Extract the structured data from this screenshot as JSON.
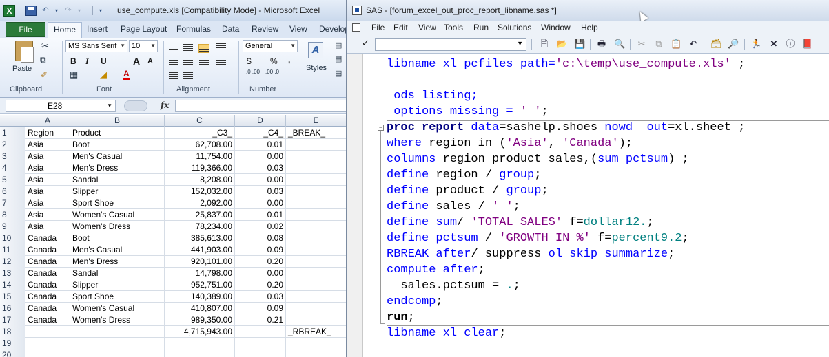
{
  "excel": {
    "title": "use_compute.xls  [Compatibility Mode]  -  Microsoft Excel",
    "app_icon_letter": "X",
    "tabs": {
      "file": "File",
      "home": "Home",
      "insert": "Insert",
      "page_layout": "Page Layout",
      "formulas": "Formulas",
      "data": "Data",
      "review": "Review",
      "view": "View",
      "developer": "Develop"
    },
    "ribbon": {
      "clipboard_label": "Clipboard",
      "paste_label": "Paste",
      "font_label": "Font",
      "font_name": "MS Sans Serif",
      "font_size": "10",
      "bold": "B",
      "italic": "I",
      "underline": "U",
      "grow_font": "A",
      "shrink_font": "A",
      "alignment_label": "Alignment",
      "number_label": "Number",
      "number_format": "General",
      "currency": "$",
      "percent": "%",
      "comma": ",",
      "inc_decimal": ".0 .00",
      "dec_decimal": ".00 .0",
      "styles_label": "Styles"
    },
    "name_box": "E28",
    "fx": "fx",
    "column_headers": [
      "A",
      "B",
      "C",
      "D",
      "E"
    ],
    "rows": [
      {
        "n": "1",
        "a": "Region",
        "b": "Product",
        "c": "_C3_",
        "d": "_C4_",
        "e": "_BREAK_"
      },
      {
        "n": "2",
        "a": "Asia",
        "b": "Boot",
        "c": "62,708.00",
        "d": "0.01",
        "e": ""
      },
      {
        "n": "3",
        "a": "Asia",
        "b": "Men's Casual",
        "c": "11,754.00",
        "d": "0.00",
        "e": ""
      },
      {
        "n": "4",
        "a": "Asia",
        "b": "Men's Dress",
        "c": "119,366.00",
        "d": "0.03",
        "e": ""
      },
      {
        "n": "5",
        "a": "Asia",
        "b": "Sandal",
        "c": "8,208.00",
        "d": "0.00",
        "e": ""
      },
      {
        "n": "6",
        "a": "Asia",
        "b": "Slipper",
        "c": "152,032.00",
        "d": "0.03",
        "e": ""
      },
      {
        "n": "7",
        "a": "Asia",
        "b": "Sport Shoe",
        "c": "2,092.00",
        "d": "0.00",
        "e": ""
      },
      {
        "n": "8",
        "a": "Asia",
        "b": "Women's Casual",
        "c": "25,837.00",
        "d": "0.01",
        "e": ""
      },
      {
        "n": "9",
        "a": "Asia",
        "b": "Women's Dress",
        "c": "78,234.00",
        "d": "0.02",
        "e": ""
      },
      {
        "n": "10",
        "a": "Canada",
        "b": "Boot",
        "c": "385,613.00",
        "d": "0.08",
        "e": ""
      },
      {
        "n": "11",
        "a": "Canada",
        "b": "Men's Casual",
        "c": "441,903.00",
        "d": "0.09",
        "e": ""
      },
      {
        "n": "12",
        "a": "Canada",
        "b": "Men's Dress",
        "c": "920,101.00",
        "d": "0.20",
        "e": ""
      },
      {
        "n": "13",
        "a": "Canada",
        "b": "Sandal",
        "c": "14,798.00",
        "d": "0.00",
        "e": ""
      },
      {
        "n": "14",
        "a": "Canada",
        "b": "Slipper",
        "c": "952,751.00",
        "d": "0.20",
        "e": ""
      },
      {
        "n": "15",
        "a": "Canada",
        "b": "Sport Shoe",
        "c": "140,389.00",
        "d": "0.03",
        "e": ""
      },
      {
        "n": "16",
        "a": "Canada",
        "b": "Women's Casual",
        "c": "410,807.00",
        "d": "0.09",
        "e": ""
      },
      {
        "n": "17",
        "a": "Canada",
        "b": "Women's Dress",
        "c": "989,350.00",
        "d": "0.21",
        "e": ""
      },
      {
        "n": "18",
        "a": "",
        "b": "",
        "c": "4,715,943.00",
        "d": "",
        "e": "_RBREAK_"
      },
      {
        "n": "19",
        "a": "",
        "b": "",
        "c": "",
        "d": "",
        "e": ""
      },
      {
        "n": "20",
        "a": "",
        "b": "",
        "c": "",
        "d": "",
        "e": ""
      }
    ]
  },
  "sas": {
    "title": "SAS - [forum_excel_out_proc_report_libname.sas *]",
    "menu": [
      "File",
      "Edit",
      "View",
      "Tools",
      "Run",
      "Solutions",
      "Window",
      "Help"
    ],
    "command_check": "✓",
    "icons": [
      "new-icon",
      "open-icon",
      "save-icon",
      "print-icon",
      "print-preview-icon",
      "cut-icon",
      "copy-icon",
      "paste-icon",
      "undo-icon",
      "libraries-icon",
      "explorer-icon",
      "run-icon",
      "clear-icon",
      "break-icon",
      "help-icon"
    ],
    "code": [
      [
        {
          "t": "libname xl pcfiles path=",
          "c": "bl"
        },
        {
          "t": "'c:\\temp\\use_compute.xls'",
          "c": "pu"
        },
        {
          "t": " ;",
          "c": "bk"
        }
      ],
      [],
      [
        {
          "t": " ods listing;",
          "c": "bl"
        }
      ],
      [
        {
          "t": " options missing = ",
          "c": "bl"
        },
        {
          "t": "' '",
          "c": "pu"
        },
        {
          "t": ";",
          "c": "bk"
        }
      ],
      [
        {
          "t": "proc report",
          "c": "kw"
        },
        {
          "t": " ",
          "c": "bk"
        },
        {
          "t": "data",
          "c": "bl"
        },
        {
          "t": "=sashelp.shoes ",
          "c": "bk"
        },
        {
          "t": "nowd",
          "c": "bl"
        },
        {
          "t": "  ",
          "c": "bk"
        },
        {
          "t": "out",
          "c": "bl"
        },
        {
          "t": "=xl.sheet ;",
          "c": "bk"
        }
      ],
      [
        {
          "t": "where",
          "c": "bl"
        },
        {
          "t": " region in (",
          "c": "bk"
        },
        {
          "t": "'Asia'",
          "c": "pu"
        },
        {
          "t": ", ",
          "c": "bk"
        },
        {
          "t": "'Canada'",
          "c": "pu"
        },
        {
          "t": ");",
          "c": "bk"
        }
      ],
      [
        {
          "t": "columns",
          "c": "bl"
        },
        {
          "t": " region product sales,(",
          "c": "bk"
        },
        {
          "t": "sum",
          "c": "bl"
        },
        {
          "t": " ",
          "c": "bk"
        },
        {
          "t": "pctsum",
          "c": "bl"
        },
        {
          "t": ") ;",
          "c": "bk"
        }
      ],
      [
        {
          "t": "define",
          "c": "bl"
        },
        {
          "t": " region / ",
          "c": "bk"
        },
        {
          "t": "group",
          "c": "bl"
        },
        {
          "t": ";",
          "c": "bk"
        }
      ],
      [
        {
          "t": "define",
          "c": "bl"
        },
        {
          "t": " product / ",
          "c": "bk"
        },
        {
          "t": "group",
          "c": "bl"
        },
        {
          "t": ";",
          "c": "bk"
        }
      ],
      [
        {
          "t": "define",
          "c": "bl"
        },
        {
          "t": " sales / ",
          "c": "bk"
        },
        {
          "t": "' '",
          "c": "pu"
        },
        {
          "t": ";",
          "c": "bk"
        }
      ],
      [
        {
          "t": "define",
          "c": "bl"
        },
        {
          "t": " ",
          "c": "bk"
        },
        {
          "t": "sum",
          "c": "bl"
        },
        {
          "t": "/ ",
          "c": "bk"
        },
        {
          "t": "'TOTAL SALES'",
          "c": "pu"
        },
        {
          "t": " f=",
          "c": "bk"
        },
        {
          "t": "dollar12.",
          "c": "tl"
        },
        {
          "t": ";",
          "c": "bk"
        }
      ],
      [
        {
          "t": "define",
          "c": "bl"
        },
        {
          "t": " ",
          "c": "bk"
        },
        {
          "t": "pctsum",
          "c": "bl"
        },
        {
          "t": " / ",
          "c": "bk"
        },
        {
          "t": "'GROWTH IN %'",
          "c": "pu"
        },
        {
          "t": " f=",
          "c": "bk"
        },
        {
          "t": "percent9.2",
          "c": "tl"
        },
        {
          "t": ";",
          "c": "bk"
        }
      ],
      [
        {
          "t": "RBREAK",
          "c": "bl"
        },
        {
          "t": " ",
          "c": "bk"
        },
        {
          "t": "after",
          "c": "bl"
        },
        {
          "t": "/ suppress ",
          "c": "bk"
        },
        {
          "t": "ol",
          "c": "bl"
        },
        {
          "t": " ",
          "c": "bk"
        },
        {
          "t": "skip",
          "c": "bl"
        },
        {
          "t": " ",
          "c": "bk"
        },
        {
          "t": "summarize",
          "c": "bl"
        },
        {
          "t": ";",
          "c": "bk"
        }
      ],
      [
        {
          "t": "compute",
          "c": "bl"
        },
        {
          "t": " ",
          "c": "bk"
        },
        {
          "t": "after",
          "c": "bl"
        },
        {
          "t": ";",
          "c": "bk"
        }
      ],
      [
        {
          "t": "  sales.pctsum = ",
          "c": "bk"
        },
        {
          "t": ".",
          "c": "tl"
        },
        {
          "t": ";",
          "c": "bk"
        }
      ],
      [
        {
          "t": "endcomp",
          "c": "bl"
        },
        {
          "t": ";",
          "c": "bk"
        }
      ],
      [
        {
          "t": "run",
          "c": "bb"
        },
        {
          "t": ";",
          "c": "bk"
        }
      ],
      [
        {
          "t": "libname xl ",
          "c": "bl"
        },
        {
          "t": "clear",
          "c": "bl"
        },
        {
          "t": ";",
          "c": "bk"
        }
      ]
    ]
  }
}
